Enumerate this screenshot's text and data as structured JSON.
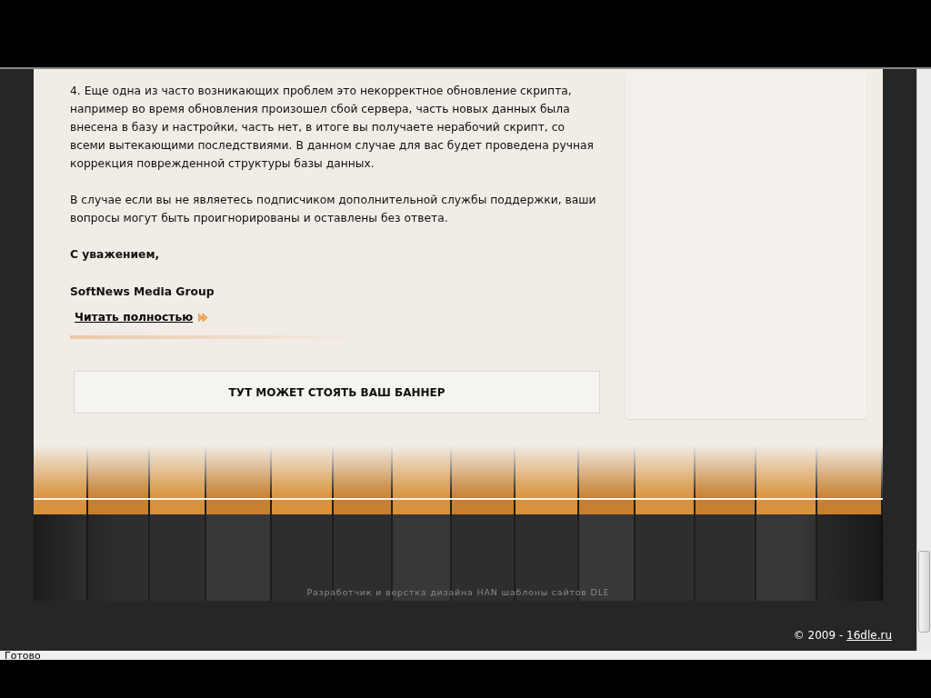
{
  "article": {
    "paragraphs": [
      "4. Еще одна из часто возникающих проблем это некорректное обновление скрипта, например во время обновления произошел сбой сервера, часть новых данных была внесена в базу и настройки, часть нет, в итоге вы получаете нерабочий скрипт, со всеми вытекающими последствиями. В данном случае для вас будет проведена ручная коррекция поврежденной структуры базы данных.",
      "В случае если вы не являетесь подписчиком дополнительной службы поддержки, ваши вопросы могут быть проигнорированы и оставлены без ответа."
    ],
    "closing": "С уважением,",
    "signature": "SoftNews Media Group",
    "read_more": "Читать полностью"
  },
  "banner": {
    "text": "ТУТ МОЖЕТ СТОЯТЬ ВАШ БАННЕР"
  },
  "footer": {
    "credits": "Разработчик и верстка дизайна HAN шаблоны сайтов DLE",
    "copyright": "© 2009 - ",
    "copyright_link": "16dle.ru"
  },
  "status_bar": {
    "text": "Готово"
  }
}
